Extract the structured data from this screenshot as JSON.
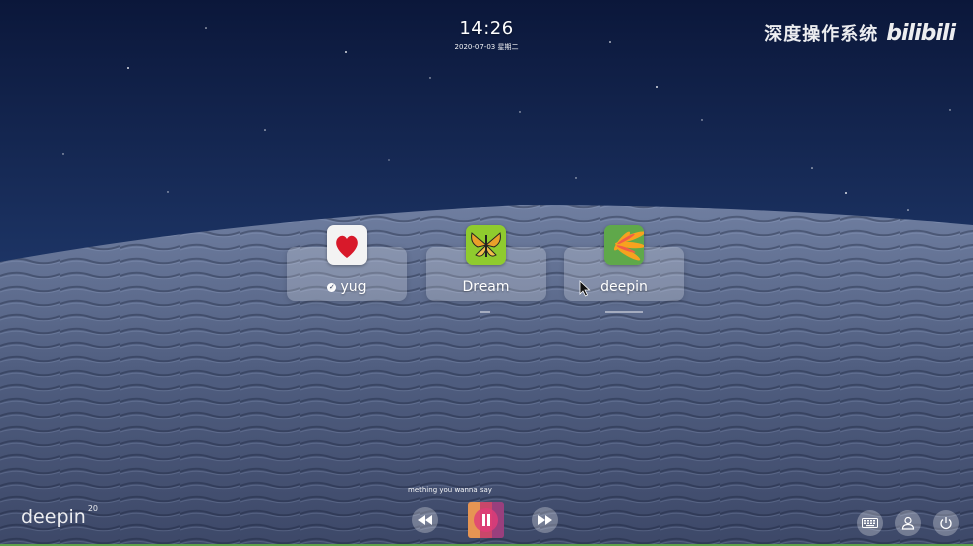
{
  "clock": {
    "time": "14:26",
    "date": "2020-07-03 星期二"
  },
  "watermark": {
    "cn": "深度操作系统",
    "bili": "bilibili"
  },
  "users": [
    {
      "name": "yug",
      "current": true,
      "avatar": "heart-avatar"
    },
    {
      "name": "Dream",
      "current": false,
      "avatar": "butterfly-avatar"
    },
    {
      "name": "deepin",
      "current": false,
      "avatar": "flower-avatar"
    }
  ],
  "logo": {
    "text": "deepin",
    "version": "20"
  },
  "media": {
    "song": "mething you wanna say",
    "state": "playing"
  },
  "tray": {
    "icons": [
      "keyboard-icon",
      "user-switch-icon",
      "power-icon"
    ]
  },
  "colors": {
    "accent_play": "#e13c78",
    "bottom_bar": "#5da14a"
  }
}
